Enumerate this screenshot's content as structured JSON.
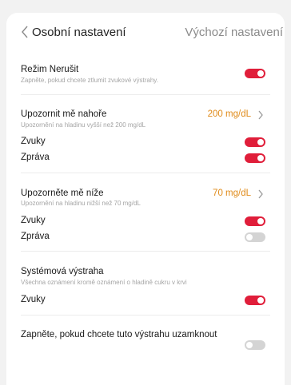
{
  "header": {
    "title": "Osobní nastavení",
    "reset_label": "Výchozí nastavení"
  },
  "dnd": {
    "title": "Režim Nerušit",
    "subtitle": "Zapněte, pokud chcete ztlumit zvukové výstrahy.",
    "enabled": true
  },
  "high_alert": {
    "title": "Upozornit mě nahoře",
    "subtitle": "Upozornění na hladinu vyšší než 200 mg/dL",
    "value": "200 mg/dL",
    "sounds_label": "Zvuky",
    "sounds_enabled": true,
    "message_label": "Zpráva",
    "message_enabled": true
  },
  "low_alert": {
    "title": "Upozorněte mě níže",
    "subtitle": "Upozornění na hladinu nižší než 70 mg/dL",
    "value": "70 mg/dL",
    "sounds_label": "Zvuky",
    "sounds_enabled": true,
    "message_label": "Zpráva",
    "message_enabled": false
  },
  "system_alert": {
    "title": "Systémová výstraha",
    "subtitle": "Všechna oznámení kromě oznámení o hladině cukru v krvi",
    "sounds_label": "Zvuky",
    "sounds_enabled": true
  },
  "lock_alert": {
    "title": "Zapněte, pokud chcete tuto výstrahu uzamknout",
    "enabled": false
  },
  "colors": {
    "toggle_on": "#e01e3a",
    "toggle_off": "#d4d4d4",
    "value_accent": "#e08b1a"
  }
}
